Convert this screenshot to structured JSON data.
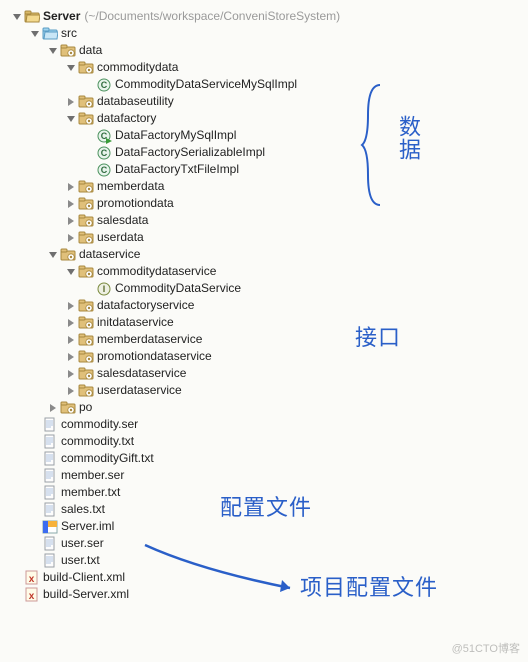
{
  "root": {
    "name": "Server",
    "path": "(~/Documents/workspace/ConveniStoreSystem)"
  },
  "tree": [
    {
      "d": 0,
      "t": "project-open",
      "a": "down",
      "lbl": "Server",
      "bold": true,
      "path": "(~/Documents/workspace/ConveniStoreSystem)"
    },
    {
      "d": 1,
      "t": "folder-src",
      "a": "down",
      "lbl": "src"
    },
    {
      "d": 2,
      "t": "package",
      "a": "down",
      "lbl": "data"
    },
    {
      "d": 3,
      "t": "package",
      "a": "down",
      "lbl": "commoditydata"
    },
    {
      "d": 4,
      "t": "class",
      "a": "none",
      "lbl": "CommodityDataServiceMySqlImpl"
    },
    {
      "d": 3,
      "t": "package",
      "a": "right",
      "lbl": "databaseutility"
    },
    {
      "d": 3,
      "t": "package",
      "a": "down",
      "lbl": "datafactory"
    },
    {
      "d": 4,
      "t": "class-run",
      "a": "none",
      "lbl": "DataFactoryMySqlImpl"
    },
    {
      "d": 4,
      "t": "class",
      "a": "none",
      "lbl": "DataFactorySerializableImpl"
    },
    {
      "d": 4,
      "t": "class",
      "a": "none",
      "lbl": "DataFactoryTxtFileImpl"
    },
    {
      "d": 3,
      "t": "package",
      "a": "right",
      "lbl": "memberdata"
    },
    {
      "d": 3,
      "t": "package",
      "a": "right",
      "lbl": "promotiondata"
    },
    {
      "d": 3,
      "t": "package",
      "a": "right",
      "lbl": "salesdata"
    },
    {
      "d": 3,
      "t": "package",
      "a": "right",
      "lbl": "userdata"
    },
    {
      "d": 2,
      "t": "package",
      "a": "down",
      "lbl": "dataservice"
    },
    {
      "d": 3,
      "t": "package",
      "a": "down",
      "lbl": "commoditydataservice"
    },
    {
      "d": 4,
      "t": "interface",
      "a": "none",
      "lbl": "CommodityDataService"
    },
    {
      "d": 3,
      "t": "package",
      "a": "right",
      "lbl": "datafactoryservice"
    },
    {
      "d": 3,
      "t": "package",
      "a": "right",
      "lbl": "initdataservice"
    },
    {
      "d": 3,
      "t": "package",
      "a": "right",
      "lbl": "memberdataservice"
    },
    {
      "d": 3,
      "t": "package",
      "a": "right",
      "lbl": "promotiondataservice"
    },
    {
      "d": 3,
      "t": "package",
      "a": "right",
      "lbl": "salesdataservice"
    },
    {
      "d": 3,
      "t": "package",
      "a": "right",
      "lbl": "userdataservice"
    },
    {
      "d": 2,
      "t": "package",
      "a": "right",
      "lbl": "po"
    },
    {
      "d": 1,
      "t": "file",
      "a": "none",
      "lbl": "commodity.ser"
    },
    {
      "d": 1,
      "t": "file",
      "a": "none",
      "lbl": "commodity.txt"
    },
    {
      "d": 1,
      "t": "file",
      "a": "none",
      "lbl": "commodityGift.txt"
    },
    {
      "d": 1,
      "t": "file",
      "a": "none",
      "lbl": "member.ser"
    },
    {
      "d": 1,
      "t": "file",
      "a": "none",
      "lbl": "member.txt"
    },
    {
      "d": 1,
      "t": "file",
      "a": "none",
      "lbl": "sales.txt"
    },
    {
      "d": 1,
      "t": "iml",
      "a": "none",
      "lbl": "Server.iml"
    },
    {
      "d": 1,
      "t": "file",
      "a": "none",
      "lbl": "user.ser"
    },
    {
      "d": 1,
      "t": "file",
      "a": "none",
      "lbl": "user.txt"
    },
    {
      "d": 0,
      "t": "ant",
      "a": "none",
      "lbl": "build-Client.xml"
    },
    {
      "d": 0,
      "t": "ant",
      "a": "none",
      "lbl": "build-Server.xml"
    }
  ],
  "annotations": {
    "a1": "数据",
    "a2": "接口",
    "a3": "配置文件",
    "a4": "项目配置文件"
  },
  "watermark": "@51CTO博客"
}
